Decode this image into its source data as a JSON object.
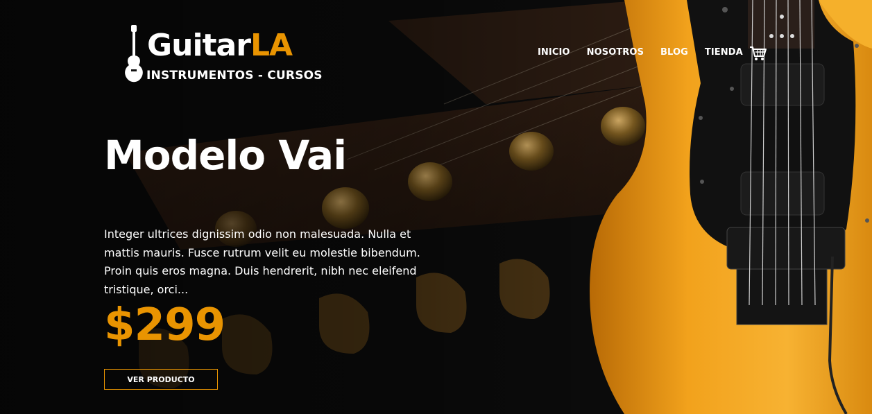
{
  "brand": {
    "name_main": "Guitar",
    "name_accent": "LA",
    "tagline": "INSTRUMENTOS - CURSOS"
  },
  "nav": {
    "items": [
      "INICIO",
      "NOSOTROS",
      "BLOG",
      "TIENDA"
    ],
    "cart_icon": "cart-icon"
  },
  "hero": {
    "title": "Modelo Vai",
    "description": "Integer ultrices dignissim odio non malesuada. Nulla et mattis mauris. Fusce rutrum velit eu molestie bibendum. Proin quis eros magna. Duis hendrerit, nibh nec eleifend tristique, orci...",
    "price": "$299",
    "cta_label": "VER PRODUCTO"
  },
  "colors": {
    "accent": "#e99401",
    "background": "#0b0b0b",
    "text": "#ffffff"
  }
}
